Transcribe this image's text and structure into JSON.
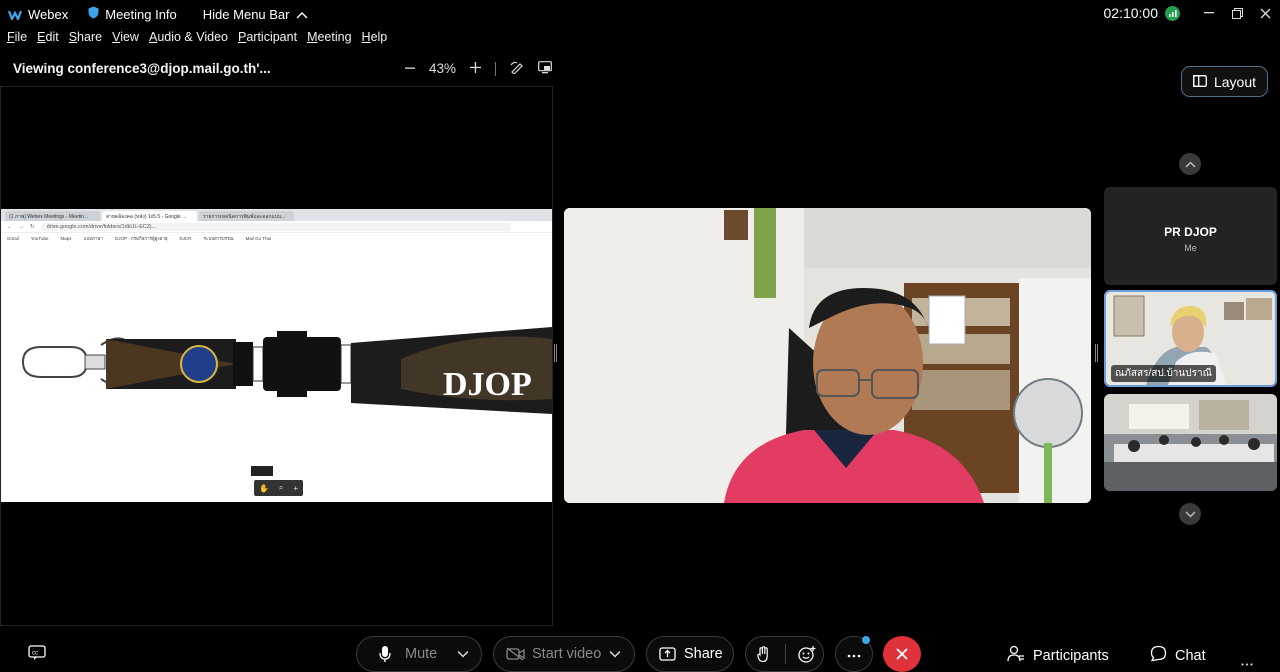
{
  "titlebar": {
    "app_name": "Webex",
    "meeting_info": "Meeting Info",
    "hide_menu": "Hide Menu Bar",
    "clock": "02:10:00"
  },
  "menubar": {
    "items": [
      {
        "u": "F",
        "rest": "ile"
      },
      {
        "u": "E",
        "rest": "dit"
      },
      {
        "u": "S",
        "rest": "hare"
      },
      {
        "u": "V",
        "rest": "iew"
      },
      {
        "u": "A",
        "rest": "udio & Video"
      },
      {
        "u": "P",
        "rest": "articipant"
      },
      {
        "u": "M",
        "rest": "eeting"
      },
      {
        "u": "H",
        "rest": "elp"
      }
    ]
  },
  "share": {
    "viewing": "Viewing conference3@djop.mail.go.th'...",
    "zoom_level": "43%",
    "browser_tabs": [
      "(1 ภาพ) Webex Meetings - Meetin...",
      "สายคล้องคอ (หลัง) 1x5.5 - Google ...",
      "รายการเทคนิคการพิมพ์และออกแบบ..."
    ],
    "browser_url": "drive.google.com/drive/folders/1dkUL-ECZj...",
    "bookmarks": [
      "Gmail",
      "YouTube",
      "Maps",
      "แปลภาษา",
      "DJOP - กรมกิจการผู้สูงอายุ",
      "DJCR",
      "ระบบสารบรรณ",
      "Mail Go Thai"
    ],
    "lanyard_text": "DJOP"
  },
  "layout_button": "Layout",
  "participants_panel": {
    "self_name": "PR DJOP",
    "self_sub": "Me",
    "tile2_label": "ณภัสสร/สป.บ้านปราณี"
  },
  "toolbar": {
    "mute": "Mute",
    "start_video": "Start video",
    "share": "Share",
    "participants": "Participants",
    "chat": "Chat"
  },
  "colors": {
    "end_call": "#e0323b",
    "layout_border": "#4d6f8a",
    "active_tile_border": "#6a9fd8"
  }
}
